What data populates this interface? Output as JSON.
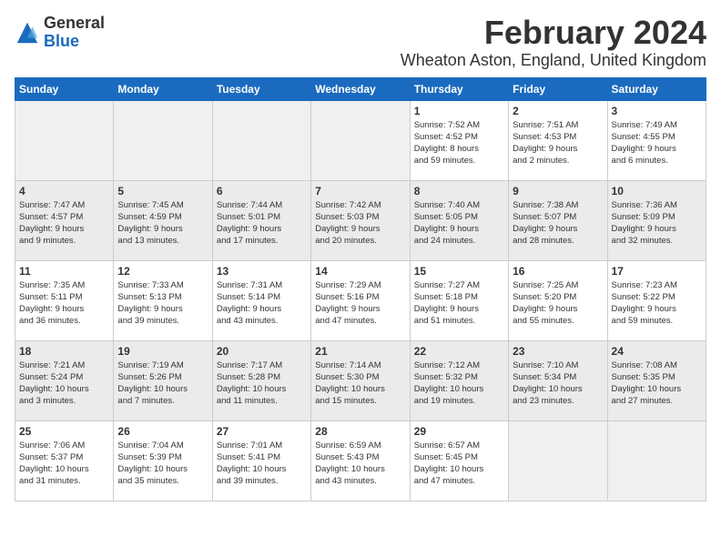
{
  "logo": {
    "general": "General",
    "blue": "Blue"
  },
  "title": "February 2024",
  "location": "Wheaton Aston, England, United Kingdom",
  "days": [
    "Sunday",
    "Monday",
    "Tuesday",
    "Wednesday",
    "Thursday",
    "Friday",
    "Saturday"
  ],
  "weeks": [
    [
      {
        "day": "",
        "info": ""
      },
      {
        "day": "",
        "info": ""
      },
      {
        "day": "",
        "info": ""
      },
      {
        "day": "",
        "info": ""
      },
      {
        "day": "1",
        "info": "Sunrise: 7:52 AM\nSunset: 4:52 PM\nDaylight: 8 hours\nand 59 minutes."
      },
      {
        "day": "2",
        "info": "Sunrise: 7:51 AM\nSunset: 4:53 PM\nDaylight: 9 hours\nand 2 minutes."
      },
      {
        "day": "3",
        "info": "Sunrise: 7:49 AM\nSunset: 4:55 PM\nDaylight: 9 hours\nand 6 minutes."
      }
    ],
    [
      {
        "day": "4",
        "info": "Sunrise: 7:47 AM\nSunset: 4:57 PM\nDaylight: 9 hours\nand 9 minutes."
      },
      {
        "day": "5",
        "info": "Sunrise: 7:45 AM\nSunset: 4:59 PM\nDaylight: 9 hours\nand 13 minutes."
      },
      {
        "day": "6",
        "info": "Sunrise: 7:44 AM\nSunset: 5:01 PM\nDaylight: 9 hours\nand 17 minutes."
      },
      {
        "day": "7",
        "info": "Sunrise: 7:42 AM\nSunset: 5:03 PM\nDaylight: 9 hours\nand 20 minutes."
      },
      {
        "day": "8",
        "info": "Sunrise: 7:40 AM\nSunset: 5:05 PM\nDaylight: 9 hours\nand 24 minutes."
      },
      {
        "day": "9",
        "info": "Sunrise: 7:38 AM\nSunset: 5:07 PM\nDaylight: 9 hours\nand 28 minutes."
      },
      {
        "day": "10",
        "info": "Sunrise: 7:36 AM\nSunset: 5:09 PM\nDaylight: 9 hours\nand 32 minutes."
      }
    ],
    [
      {
        "day": "11",
        "info": "Sunrise: 7:35 AM\nSunset: 5:11 PM\nDaylight: 9 hours\nand 36 minutes."
      },
      {
        "day": "12",
        "info": "Sunrise: 7:33 AM\nSunset: 5:13 PM\nDaylight: 9 hours\nand 39 minutes."
      },
      {
        "day": "13",
        "info": "Sunrise: 7:31 AM\nSunset: 5:14 PM\nDaylight: 9 hours\nand 43 minutes."
      },
      {
        "day": "14",
        "info": "Sunrise: 7:29 AM\nSunset: 5:16 PM\nDaylight: 9 hours\nand 47 minutes."
      },
      {
        "day": "15",
        "info": "Sunrise: 7:27 AM\nSunset: 5:18 PM\nDaylight: 9 hours\nand 51 minutes."
      },
      {
        "day": "16",
        "info": "Sunrise: 7:25 AM\nSunset: 5:20 PM\nDaylight: 9 hours\nand 55 minutes."
      },
      {
        "day": "17",
        "info": "Sunrise: 7:23 AM\nSunset: 5:22 PM\nDaylight: 9 hours\nand 59 minutes."
      }
    ],
    [
      {
        "day": "18",
        "info": "Sunrise: 7:21 AM\nSunset: 5:24 PM\nDaylight: 10 hours\nand 3 minutes."
      },
      {
        "day": "19",
        "info": "Sunrise: 7:19 AM\nSunset: 5:26 PM\nDaylight: 10 hours\nand 7 minutes."
      },
      {
        "day": "20",
        "info": "Sunrise: 7:17 AM\nSunset: 5:28 PM\nDaylight: 10 hours\nand 11 minutes."
      },
      {
        "day": "21",
        "info": "Sunrise: 7:14 AM\nSunset: 5:30 PM\nDaylight: 10 hours\nand 15 minutes."
      },
      {
        "day": "22",
        "info": "Sunrise: 7:12 AM\nSunset: 5:32 PM\nDaylight: 10 hours\nand 19 minutes."
      },
      {
        "day": "23",
        "info": "Sunrise: 7:10 AM\nSunset: 5:34 PM\nDaylight: 10 hours\nand 23 minutes."
      },
      {
        "day": "24",
        "info": "Sunrise: 7:08 AM\nSunset: 5:35 PM\nDaylight: 10 hours\nand 27 minutes."
      }
    ],
    [
      {
        "day": "25",
        "info": "Sunrise: 7:06 AM\nSunset: 5:37 PM\nDaylight: 10 hours\nand 31 minutes."
      },
      {
        "day": "26",
        "info": "Sunrise: 7:04 AM\nSunset: 5:39 PM\nDaylight: 10 hours\nand 35 minutes."
      },
      {
        "day": "27",
        "info": "Sunrise: 7:01 AM\nSunset: 5:41 PM\nDaylight: 10 hours\nand 39 minutes."
      },
      {
        "day": "28",
        "info": "Sunrise: 6:59 AM\nSunset: 5:43 PM\nDaylight: 10 hours\nand 43 minutes."
      },
      {
        "day": "29",
        "info": "Sunrise: 6:57 AM\nSunset: 5:45 PM\nDaylight: 10 hours\nand 47 minutes."
      },
      {
        "day": "",
        "info": ""
      },
      {
        "day": "",
        "info": ""
      }
    ]
  ]
}
